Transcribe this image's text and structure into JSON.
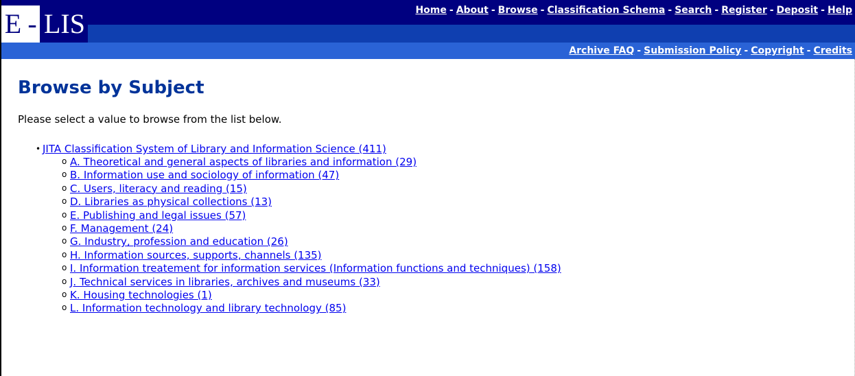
{
  "logo": {
    "text_e": "E",
    "text_dash": "-",
    "text_lis": "LIS"
  },
  "nav": {
    "primary": [
      {
        "label": "Home"
      },
      {
        "label": "About"
      },
      {
        "label": "Browse"
      },
      {
        "label": "Classification Schema"
      },
      {
        "label": "Search"
      },
      {
        "label": "Register"
      },
      {
        "label": "Deposit"
      },
      {
        "label": "Help"
      }
    ],
    "secondary": [
      {
        "label": "Archive FAQ"
      },
      {
        "label": "Submission Policy"
      },
      {
        "label": "Copyright"
      },
      {
        "label": "Credits"
      }
    ],
    "separator": "-"
  },
  "main": {
    "title": "Browse by Subject",
    "instructions": "Please select a value to browse from the list below.",
    "root": {
      "label": "JITA Classification System of Library and Information Science (411)"
    },
    "subjects": [
      {
        "label": "A. Theoretical and general aspects of libraries and information (29)"
      },
      {
        "label": "B. Information use and sociology of information (47)"
      },
      {
        "label": "C. Users, literacy and reading (15)"
      },
      {
        "label": "D. Libraries as physical collections (13)"
      },
      {
        "label": "E. Publishing and legal issues (57)"
      },
      {
        "label": "F. Management (24)"
      },
      {
        "label": "G. Industry, profession and education (26)"
      },
      {
        "label": "H. Information sources, supports, channels (135)"
      },
      {
        "label": "I. Information treatement for information services (Information functions and techniques) (158)"
      },
      {
        "label": "J. Technical services in libraries, archives and museums (33)"
      },
      {
        "label": "K. Housing technologies (1)"
      },
      {
        "label": "L. Information technology and library technology (85)"
      }
    ]
  },
  "colors": {
    "header_dark": "#000080",
    "header_mid": "#0f3fb0",
    "header_light": "#2a63d6",
    "title": "#003399",
    "link": "#0000ee"
  }
}
